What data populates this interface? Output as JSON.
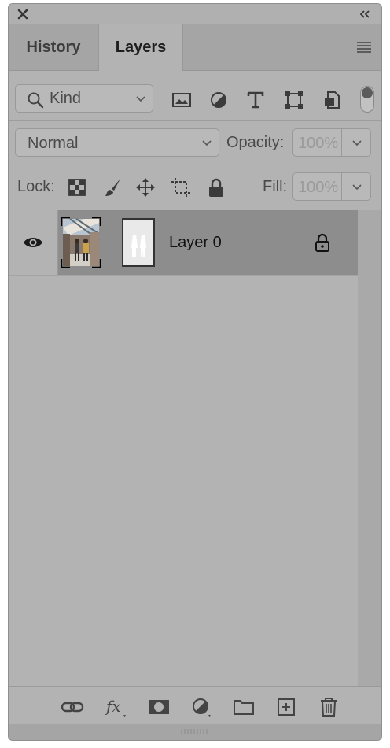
{
  "tabs": {
    "history": "History",
    "layers": "Layers"
  },
  "filter": {
    "kind_label": "Kind",
    "icons": [
      "pixel-layer-filter-icon",
      "adjustment-layer-filter-icon",
      "type-layer-filter-icon",
      "shape-layer-filter-icon",
      "smart-object-filter-icon"
    ]
  },
  "blend": {
    "mode": "Normal",
    "opacity_label": "Opacity:",
    "opacity_value": "100%"
  },
  "lock": {
    "label": "Lock:",
    "fill_label": "Fill:",
    "fill_value": "100%",
    "icons": [
      "lock-transparent-pixels-icon",
      "lock-image-pixels-icon",
      "lock-position-icon",
      "lock-artboard-icon",
      "lock-all-icon"
    ]
  },
  "layers": [
    {
      "name": "Layer 0",
      "visible": true,
      "locked": true,
      "selected": true
    }
  ],
  "bottom_icons": [
    "link-layers-icon",
    "layer-style-fx-icon",
    "add-mask-icon",
    "new-adjustment-layer-icon",
    "new-group-folder-icon",
    "new-layer-icon",
    "delete-layer-icon"
  ]
}
